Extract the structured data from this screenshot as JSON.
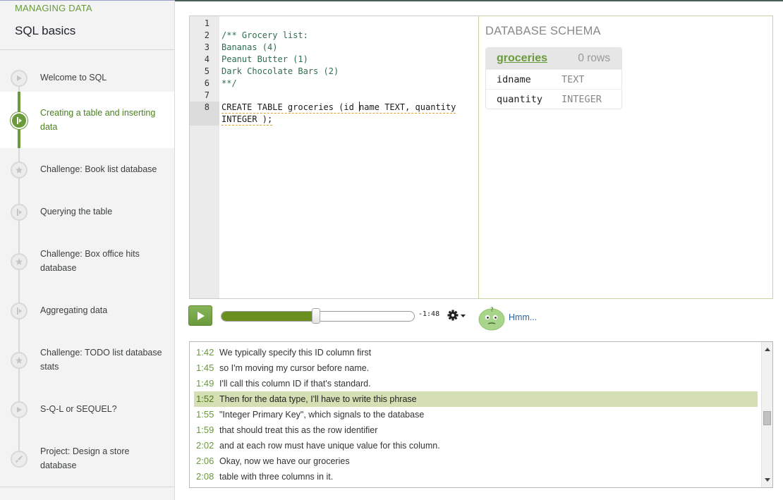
{
  "sidebar": {
    "section_label": "MANAGING DATA",
    "unit_title": "SQL basics",
    "lessons": [
      {
        "label": "Welcome to SQL",
        "icon": "play-icon",
        "active": false
      },
      {
        "label": "Creating a table and inserting data",
        "icon": "talkthrough-icon",
        "active": true
      },
      {
        "label": "Challenge: Book list database",
        "icon": "challenge-star-icon",
        "active": false
      },
      {
        "label": "Querying the table",
        "icon": "talkthrough-icon",
        "active": false
      },
      {
        "label": "Challenge: Box office hits database",
        "icon": "challenge-star-icon",
        "active": false
      },
      {
        "label": "Aggregating data",
        "icon": "talkthrough-icon",
        "active": false
      },
      {
        "label": "Challenge: TODO list database stats",
        "icon": "challenge-star-icon",
        "active": false
      },
      {
        "label": "S-Q-L or SEQUEL?",
        "icon": "play-icon",
        "active": false
      },
      {
        "label": "Project: Design a store database",
        "icon": "project-rocket-icon",
        "active": false
      }
    ]
  },
  "editor": {
    "line_numbers": [
      "1",
      "2",
      "3",
      "4",
      "5",
      "6",
      "7",
      "8"
    ],
    "lines": {
      "l2": "/** Grocery list:",
      "l3": "Bananas (4)",
      "l4": "Peanut Butter (1)",
      "l5": "Dark Chocolate Bars (2)",
      "l6": "**/",
      "l8a_before": "CREATE TABLE groceries (id ",
      "l8a_after": "name TEXT, quantity",
      "l8b": "INTEGER );"
    }
  },
  "schema": {
    "title": "DATABASE SCHEMA",
    "table_name": "groceries",
    "row_count": "0 rows",
    "columns": [
      {
        "name": "idname",
        "type": "TEXT"
      },
      {
        "name": "quantity",
        "type": "INTEGER"
      }
    ]
  },
  "player": {
    "progress": 0.49,
    "time_remaining": "-1:48",
    "help_label": "Hmm...",
    "gear_icon": "gear-icon",
    "avatar_icon": "hmm-avatar-icon",
    "accent_color": "#6a9a3b"
  },
  "transcript": [
    {
      "time": "1:42",
      "text": "We typically specify this ID column first",
      "current": false
    },
    {
      "time": "1:45",
      "text": "so I'm moving my cursor before name.",
      "current": false
    },
    {
      "time": "1:49",
      "text": "I'll call this column ID if that's standard.",
      "current": false
    },
    {
      "time": "1:52",
      "text": "Then for the data type, I'll have to write this phrase",
      "current": true
    },
    {
      "time": "1:55",
      "text": "\"Integer Primary Key\", which signals to the database",
      "current": false
    },
    {
      "time": "1:59",
      "text": "that should treat this as the row identifier",
      "current": false
    },
    {
      "time": "2:02",
      "text": "and at each row must have unique value for this column.",
      "current": false
    },
    {
      "time": "2:06",
      "text": "Okay, now we have our groceries",
      "current": false
    },
    {
      "time": "2:08",
      "text": "table with three columns in it.",
      "current": false
    }
  ]
}
